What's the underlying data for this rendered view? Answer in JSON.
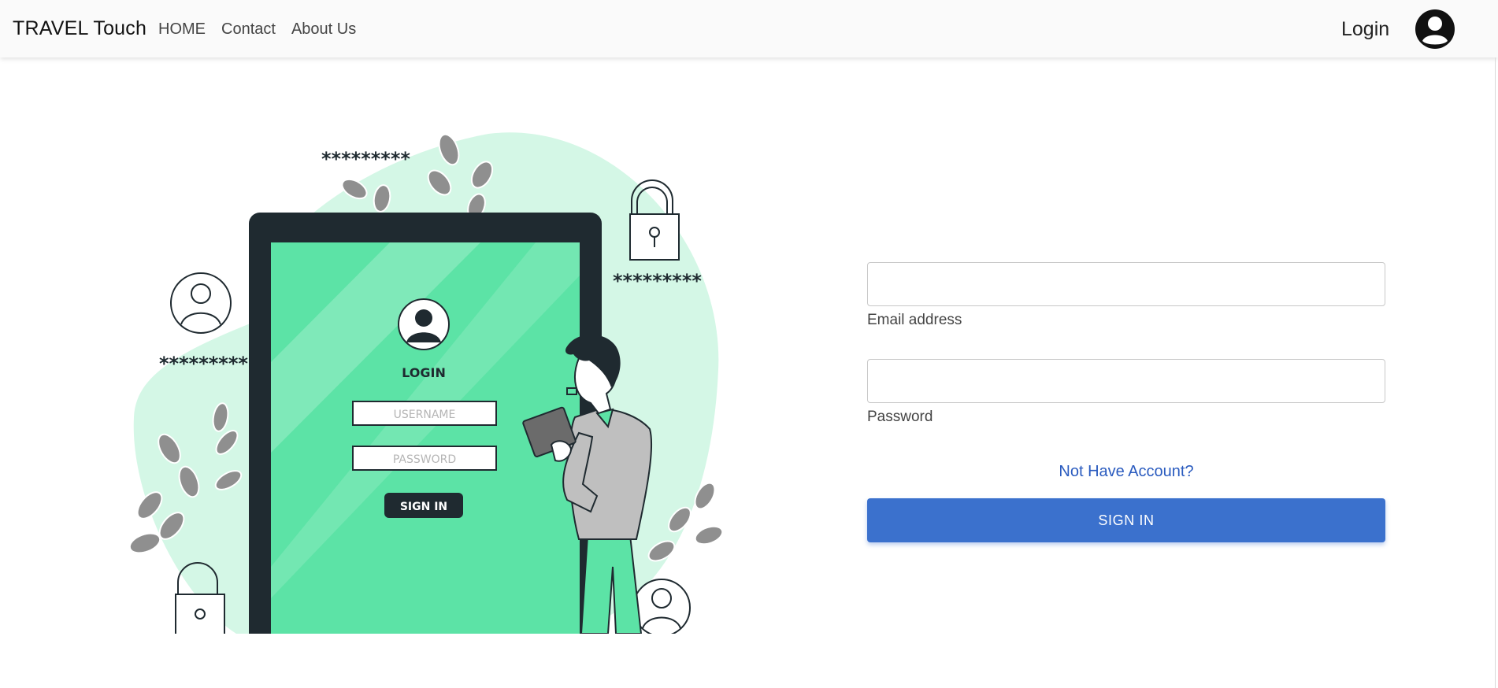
{
  "navbar": {
    "brand": "TRAVEL Touch",
    "links": [
      "HOME",
      "Contact",
      "About Us"
    ],
    "login_label": "Login",
    "avatar_icon": "user-circle-icon"
  },
  "illustration": {
    "stars": [
      "*********",
      "*********",
      "*********"
    ],
    "screen_title": "LOGIN",
    "username_placeholder": "USERNAME",
    "password_placeholder": "PASSWORD",
    "button_label": "SIGN IN",
    "colors": {
      "blob": "#d4f7e6",
      "screen": "#5ce3a6",
      "frame": "#1f2a30",
      "leaves": "#8f8f8f"
    }
  },
  "form": {
    "email": {
      "value": "",
      "label": "Email address"
    },
    "password": {
      "value": "",
      "label": "Password"
    },
    "signup_link": "Not Have Account?",
    "signin_button": "SIGN IN",
    "accent": "#3b71cd",
    "link_color": "#2a5bbf"
  }
}
